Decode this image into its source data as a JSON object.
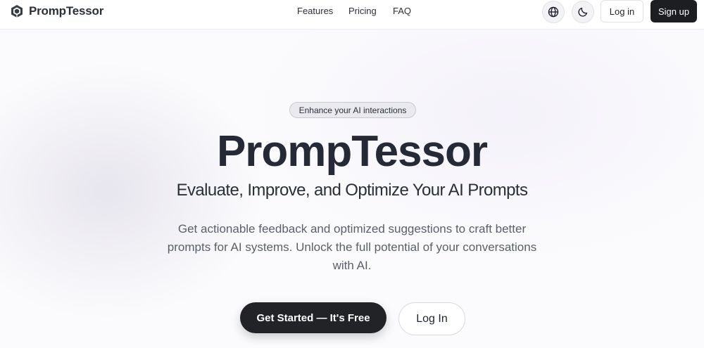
{
  "header": {
    "brand_name": "PrompTessor",
    "nav": {
      "features": "Features",
      "pricing": "Pricing",
      "faq": "FAQ"
    },
    "language_icon": "globe-icon",
    "theme_icon": "moon-icon",
    "login_label": "Log in",
    "signup_label": "Sign up"
  },
  "hero": {
    "badge": "Enhance your AI interactions",
    "title": "PrompTessor",
    "subtitle": "Evaluate, Improve, and Optimize Your AI Prompts",
    "description": "Get actionable feedback and optimized suggestions to craft better prompts for AI systems. Unlock the full potential of your conversations with AI.",
    "cta_primary": "Get Started — It's Free",
    "cta_secondary": "Log In"
  },
  "colors": {
    "primary_button": "#222326",
    "badge_bg": "#e9e9ee",
    "title": "#262a36",
    "body_text": "#5a5f6b"
  }
}
